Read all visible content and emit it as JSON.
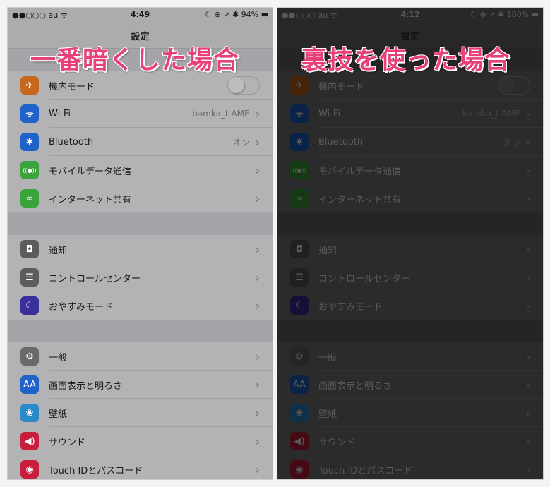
{
  "panels": [
    {
      "title": "一番暗くした場合",
      "status": {
        "carrier": "●●○○○ au ᯤ",
        "time": "4:49",
        "right": "☾ ⊕ ➚ ✱ 94% ▬"
      },
      "nav_title": "設定"
    },
    {
      "title": "裏技を使った場合",
      "status": {
        "carrier": "●●○○○ au ᯤ",
        "time": "4:12",
        "right": "☾ ⊕ ➚ ✱ 100% ▬"
      },
      "nav_title": "設定"
    }
  ],
  "groups": [
    [
      {
        "label": "機内モード",
        "icon": "airplane-icon",
        "glyph": "✈",
        "color": "#c8681c",
        "toggle": true
      },
      {
        "label": "Wi-Fi",
        "icon": "wifi-icon",
        "glyph": "ᯤ",
        "color": "#1f63c8",
        "value": "bamka_t AME"
      },
      {
        "label": "Bluetooth",
        "icon": "bluetooth-icon",
        "glyph": "✱",
        "color": "#1f63c8",
        "value": "オン"
      },
      {
        "label": "モバイルデータ通信",
        "icon": "antenna-icon",
        "glyph": "((●))",
        "color": "#3ba33b"
      },
      {
        "label": "インターネット共有",
        "icon": "link-icon",
        "glyph": "∞",
        "color": "#3ba33b"
      }
    ],
    [
      {
        "label": "通知",
        "icon": "notification-icon",
        "glyph": "◘",
        "color": "#5c5c5e"
      },
      {
        "label": "コントロールセンター",
        "icon": "control-center-icon",
        "glyph": "☰",
        "color": "#5c5c5e"
      },
      {
        "label": "おやすみモード",
        "icon": "moon-icon",
        "glyph": "☾",
        "color": "#3b2f9e"
      }
    ],
    [
      {
        "label": "一般",
        "icon": "gear-icon",
        "glyph": "⚙",
        "color": "#6a6a6c"
      },
      {
        "label": "画面表示と明るさ",
        "icon": "display-icon",
        "glyph": "AA",
        "color": "#1f63c8"
      },
      {
        "label": "壁紙",
        "icon": "wallpaper-icon",
        "glyph": "❀",
        "color": "#2a8ac8"
      },
      {
        "label": "サウンド",
        "icon": "sound-icon",
        "glyph": "◀)",
        "color": "#c81e3c"
      },
      {
        "label": "Touch IDとパスコード",
        "icon": "fingerprint-icon",
        "glyph": "◉",
        "color": "#c81e3c"
      }
    ]
  ],
  "chevron": "›"
}
